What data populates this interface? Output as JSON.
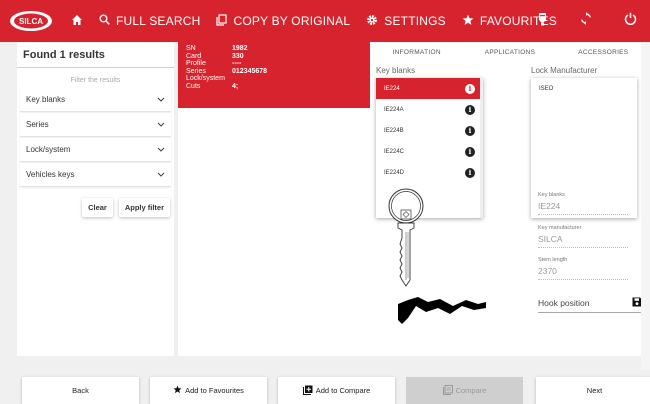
{
  "nav": {
    "full_search": "FULL SEARCH",
    "copy_by_original": "COPY BY ORIGINAL",
    "settings": "SETTINGS",
    "favourites": "FAVOURITES",
    "logo_text": "SILCA"
  },
  "filter_panel": {
    "results_title": "Found 1 results",
    "hint": "Filter the results",
    "sections": [
      "Key blanks",
      "Series",
      "Lock/system",
      "Vehicles keys"
    ],
    "clear_label": "Clear",
    "apply_label": "Apply filter"
  },
  "result_card": {
    "rows": [
      {
        "key": "SN",
        "value": "1982"
      },
      {
        "key": "Card",
        "value": "330"
      },
      {
        "key": "Profile",
        "value": "----"
      },
      {
        "key": "Series",
        "value": "012345678"
      },
      {
        "key": "Lock/system",
        "value": ""
      },
      {
        "key": "Cuts",
        "value": "4;"
      }
    ]
  },
  "detail": {
    "tabs": [
      "INFORMATION",
      "APPLICATIONS",
      "ACCESSORIES"
    ],
    "key_blanks_label": "Key blanks",
    "key_blanks": [
      "IE224",
      "IE224A",
      "IE224B",
      "IE224C",
      "IE224D"
    ],
    "selected_key_blank": "IE224",
    "lock_manufacturer_label": "Lock Manufacturer",
    "lock_manufacturers": [
      "ISEO"
    ],
    "fields": [
      {
        "label": "Key blanks",
        "value": "IE224"
      },
      {
        "label": "Key manufacturer",
        "value": "SILCA"
      },
      {
        "label": "Stem length",
        "value": "2370"
      }
    ],
    "hook_position_label": "Hook position"
  },
  "bottom": {
    "back": "Back",
    "add_favourites": "Add to Favourites",
    "add_compare": "Add to Compare",
    "compare": "Compare",
    "next": "Next"
  },
  "colors": {
    "brand_red": "#d7232d"
  }
}
